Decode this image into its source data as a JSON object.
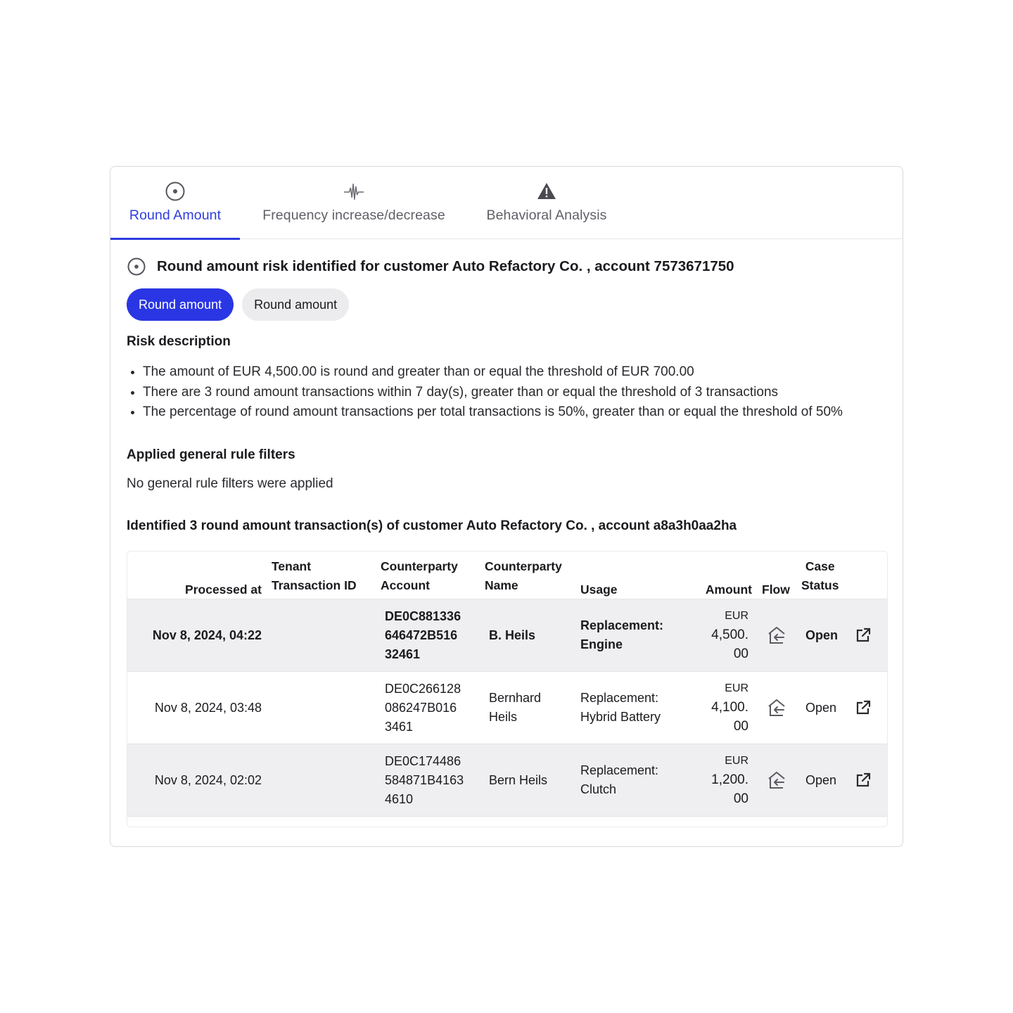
{
  "tabs": [
    {
      "label": "Round Amount",
      "icon": "target-icon",
      "active": true
    },
    {
      "label": "Frequency increase/decrease",
      "icon": "pulse-icon",
      "active": false
    },
    {
      "label": "Behavioral Analysis",
      "icon": "warning-icon",
      "active": false
    }
  ],
  "risk": {
    "heading": "Round amount risk identified for customer  Auto Refactory Co. , account  7573671750",
    "chips": [
      "Round amount",
      "Round amount"
    ],
    "description_title": "Risk description",
    "bullets": [
      "The amount of EUR 4,500.00 is round and greater than or equal the threshold of EUR 700.00",
      "There are 3 round amount transactions within 7 day(s), greater than or equal the threshold of 3 transactions",
      "The percentage of round amount transactions per total transactions is 50%, greater than or equal the threshold of 50%"
    ],
    "filters_title": "Applied general rule filters",
    "filters_text": "No general rule filters were applied",
    "table_title": "Identified 3 round amount transaction(s) of customer Auto Refactory Co. , account  a8a3h0aa2ha"
  },
  "table": {
    "headers": {
      "processed_at": "Processed at",
      "tenant_1": "Tenant",
      "tenant_2": "Transaction ID",
      "cp_account_1": "Counterparty",
      "cp_account_2": "Account",
      "cp_name_1": "Counterparty",
      "cp_name_2": "Name",
      "usage": "Usage",
      "amount": "Amount",
      "flow": "Flow",
      "case_1": "Case",
      "case_2": "Status"
    },
    "rows": [
      {
        "processed_at": "Nov 8, 2024, 04:22",
        "tenant_transaction_id": "",
        "cp_account": [
          "DE0C881336",
          "646472B516",
          "32461"
        ],
        "cp_name": [
          "B. Heils"
        ],
        "usage": [
          "Replacement:",
          "Engine"
        ],
        "amount": [
          "EUR",
          "4,500.",
          "00"
        ],
        "flow_icon": "incoming-icon",
        "case_status": "Open",
        "highlighted": true
      },
      {
        "processed_at": "Nov 8, 2024, 03:48",
        "tenant_transaction_id": "",
        "cp_account": [
          "DE0C266128",
          "086247B016",
          "3461"
        ],
        "cp_name": [
          "Bernhard",
          "Heils"
        ],
        "usage": [
          "Replacement:",
          "Hybrid Battery"
        ],
        "amount": [
          "EUR",
          "4,100.",
          "00"
        ],
        "flow_icon": "incoming-icon",
        "case_status": "Open",
        "highlighted": false
      },
      {
        "processed_at": "Nov 8, 2024, 02:02",
        "tenant_transaction_id": "",
        "cp_account": [
          "DE0C174486",
          "584871B4163",
          "4610"
        ],
        "cp_name": [
          "Bern Heils"
        ],
        "usage": [
          "Replacement:",
          "Clutch"
        ],
        "amount": [
          "EUR",
          "1,200.",
          "00"
        ],
        "flow_icon": "incoming-icon",
        "case_status": "Open",
        "highlighted": false
      }
    ]
  },
  "colors": {
    "accent": "#2d3ce0",
    "chip_primary": "#2a36e3",
    "chip_secondary": "#ececee",
    "row_shade": "#efeff1"
  }
}
